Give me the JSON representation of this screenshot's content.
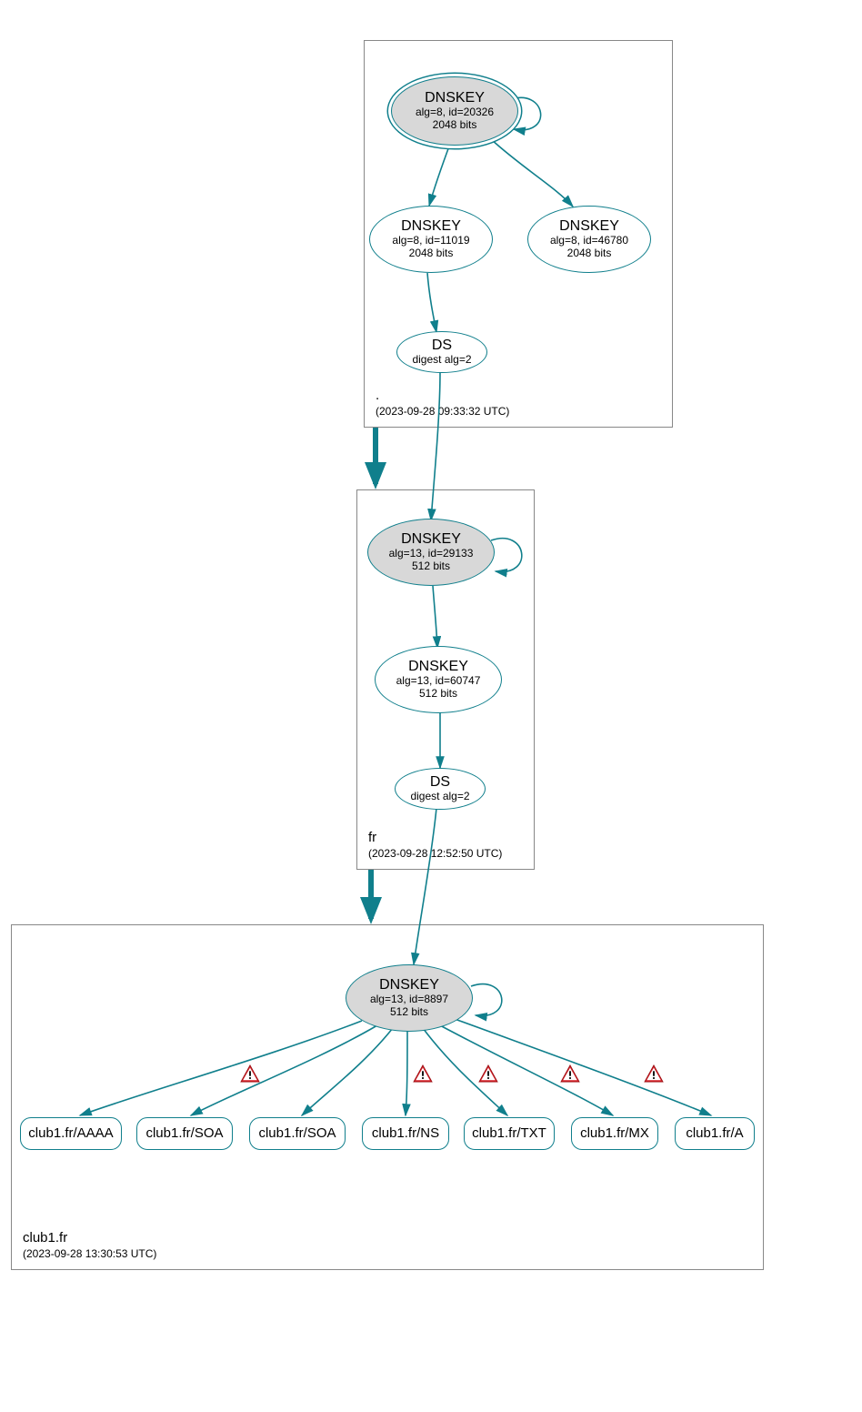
{
  "colors": {
    "stroke": "#107f8c",
    "shade": "#d8d8d8",
    "border": "#888888"
  },
  "zones": {
    "root": {
      "name": ".",
      "timestamp": "(2023-09-28 09:33:32 UTC)"
    },
    "fr": {
      "name": "fr",
      "timestamp": "(2023-09-28 12:52:50 UTC)"
    },
    "club1": {
      "name": "club1.fr",
      "timestamp": "(2023-09-28 13:30:53 UTC)"
    }
  },
  "nodes": {
    "root_ksk": {
      "title": "DNSKEY",
      "line1": "alg=8, id=20326",
      "line2": "2048 bits"
    },
    "root_zsk": {
      "title": "DNSKEY",
      "line1": "alg=8, id=11019",
      "line2": "2048 bits"
    },
    "root_k2": {
      "title": "DNSKEY",
      "line1": "alg=8, id=46780",
      "line2": "2048 bits"
    },
    "root_ds": {
      "title": "DS",
      "line1": "digest alg=2",
      "line2": ""
    },
    "fr_ksk": {
      "title": "DNSKEY",
      "line1": "alg=13, id=29133",
      "line2": "512 bits"
    },
    "fr_zsk": {
      "title": "DNSKEY",
      "line1": "alg=13, id=60747",
      "line2": "512 bits"
    },
    "fr_ds": {
      "title": "DS",
      "line1": "digest alg=2",
      "line2": ""
    },
    "club1_ksk": {
      "title": "DNSKEY",
      "line1": "alg=13, id=8897",
      "line2": "512 bits"
    }
  },
  "rrsets": {
    "aaaa": "club1.fr/AAAA",
    "soa1": "club1.fr/SOA",
    "soa2": "club1.fr/SOA",
    "ns": "club1.fr/NS",
    "txt": "club1.fr/TXT",
    "mx": "club1.fr/MX",
    "a": "club1.fr/A"
  },
  "icons": {
    "warning": "warning-triangle"
  },
  "chart_data": {
    "type": "graph",
    "description": "DNSSEC chain-of-trust / authentication graph for club1.fr",
    "zones": [
      {
        "name": ".",
        "analyzed": "2023-09-28 09:33:32 UTC"
      },
      {
        "name": "fr",
        "analyzed": "2023-09-28 12:52:50 UTC"
      },
      {
        "name": "club1.fr",
        "analyzed": "2023-09-28 13:30:53 UTC"
      }
    ],
    "nodes": [
      {
        "id": "root_ksk",
        "zone": ".",
        "type": "DNSKEY",
        "alg": 8,
        "key_id": 20326,
        "bits": 2048,
        "sep": true
      },
      {
        "id": "root_zsk",
        "zone": ".",
        "type": "DNSKEY",
        "alg": 8,
        "key_id": 11019,
        "bits": 2048,
        "sep": false
      },
      {
        "id": "root_k2",
        "zone": ".",
        "type": "DNSKEY",
        "alg": 8,
        "key_id": 46780,
        "bits": 2048,
        "sep": false
      },
      {
        "id": "root_ds",
        "zone": ".",
        "type": "DS",
        "digest_alg": 2
      },
      {
        "id": "fr_ksk",
        "zone": "fr",
        "type": "DNSKEY",
        "alg": 13,
        "key_id": 29133,
        "bits": 512,
        "sep": true
      },
      {
        "id": "fr_zsk",
        "zone": "fr",
        "type": "DNSKEY",
        "alg": 13,
        "key_id": 60747,
        "bits": 512,
        "sep": false
      },
      {
        "id": "fr_ds",
        "zone": "fr",
        "type": "DS",
        "digest_alg": 2
      },
      {
        "id": "club1_ksk",
        "zone": "club1.fr",
        "type": "DNSKEY",
        "alg": 13,
        "key_id": 8897,
        "bits": 512,
        "sep": true
      },
      {
        "id": "rr_aaaa",
        "zone": "club1.fr",
        "type": "RRset",
        "name": "club1.fr",
        "rrtype": "AAAA"
      },
      {
        "id": "rr_soa1",
        "zone": "club1.fr",
        "type": "RRset",
        "name": "club1.fr",
        "rrtype": "SOA"
      },
      {
        "id": "rr_soa2",
        "zone": "club1.fr",
        "type": "RRset",
        "name": "club1.fr",
        "rrtype": "SOA"
      },
      {
        "id": "rr_ns",
        "zone": "club1.fr",
        "type": "RRset",
        "name": "club1.fr",
        "rrtype": "NS"
      },
      {
        "id": "rr_txt",
        "zone": "club1.fr",
        "type": "RRset",
        "name": "club1.fr",
        "rrtype": "TXT"
      },
      {
        "id": "rr_mx",
        "zone": "club1.fr",
        "type": "RRset",
        "name": "club1.fr",
        "rrtype": "MX"
      },
      {
        "id": "rr_a",
        "zone": "club1.fr",
        "type": "RRset",
        "name": "club1.fr",
        "rrtype": "A"
      }
    ],
    "edges": [
      {
        "from": "root_ksk",
        "to": "root_ksk",
        "kind": "self-sig"
      },
      {
        "from": "root_ksk",
        "to": "root_zsk",
        "kind": "signs"
      },
      {
        "from": "root_ksk",
        "to": "root_k2",
        "kind": "signs"
      },
      {
        "from": "root_zsk",
        "to": "root_ds",
        "kind": "signs"
      },
      {
        "from": "root_ds",
        "to": "fr_ksk",
        "kind": "ds-match"
      },
      {
        "from": ".",
        "to": "fr",
        "kind": "delegation"
      },
      {
        "from": "fr_ksk",
        "to": "fr_ksk",
        "kind": "self-sig"
      },
      {
        "from": "fr_ksk",
        "to": "fr_zsk",
        "kind": "signs"
      },
      {
        "from": "fr_zsk",
        "to": "fr_ds",
        "kind": "signs"
      },
      {
        "from": "fr_ds",
        "to": "club1_ksk",
        "kind": "ds-match"
      },
      {
        "from": "fr",
        "to": "club1.fr",
        "kind": "delegation"
      },
      {
        "from": "club1_ksk",
        "to": "club1_ksk",
        "kind": "self-sig"
      },
      {
        "from": "club1_ksk",
        "to": "rr_aaaa",
        "kind": "signs",
        "status": "secure"
      },
      {
        "from": "club1_ksk",
        "to": "rr_soa1",
        "kind": "signs",
        "status": "warning"
      },
      {
        "from": "club1_ksk",
        "to": "rr_soa2",
        "kind": "signs",
        "status": "secure"
      },
      {
        "from": "club1_ksk",
        "to": "rr_ns",
        "kind": "signs",
        "status": "warning"
      },
      {
        "from": "club1_ksk",
        "to": "rr_txt",
        "kind": "signs",
        "status": "warning"
      },
      {
        "from": "club1_ksk",
        "to": "rr_mx",
        "kind": "signs",
        "status": "warning"
      },
      {
        "from": "club1_ksk",
        "to": "rr_a",
        "kind": "signs",
        "status": "warning"
      }
    ]
  }
}
